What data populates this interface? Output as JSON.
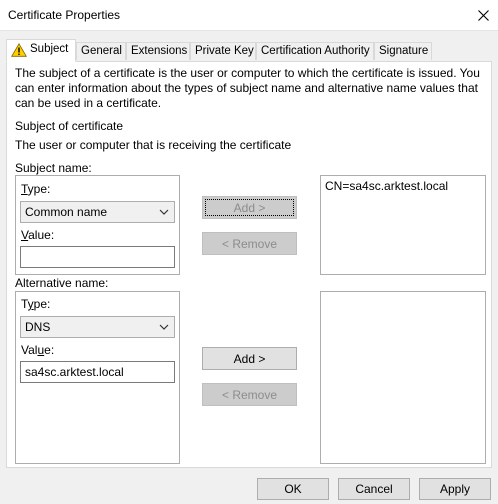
{
  "window": {
    "title": "Certificate Properties"
  },
  "tabs": [
    {
      "label": "Subject",
      "active": true
    },
    {
      "label": "General"
    },
    {
      "label": "Extensions"
    },
    {
      "label": "Private Key"
    },
    {
      "label": "Certification Authority"
    },
    {
      "label": "Signature"
    }
  ],
  "intro_text": "The subject of a certificate is the user or computer to which the certificate is issued. You can enter information about the types of subject name and alternative name values that can be used in a certificate.",
  "subject_heading": "Subject of certificate",
  "subject_desc": "The user or computer that is receiving the certificate",
  "subject_name": {
    "label": "Subject name:",
    "type_label": "Type:",
    "type_value": "Common name",
    "value_label": "Value:",
    "value": "",
    "add_button": "Add >",
    "remove_button": "< Remove",
    "list_items": [
      "CN=sa4sc.arktest.local"
    ]
  },
  "alternative_name": {
    "label": "Alternative name:",
    "type_label": "Type:",
    "type_value": "DNS",
    "value_label": "Value:",
    "value": "sa4sc.arktest.local",
    "add_button": "Add >",
    "remove_button": "< Remove",
    "list_items": []
  },
  "buttons": {
    "ok": "OK",
    "cancel": "Cancel",
    "apply": "Apply"
  },
  "icons": {
    "warning": "warning-icon",
    "close": "close-icon",
    "dropdown": "chevron-down-icon"
  },
  "colors": {
    "warning_fill": "#ffcc00",
    "disabled_text": "#8c8c8c"
  }
}
